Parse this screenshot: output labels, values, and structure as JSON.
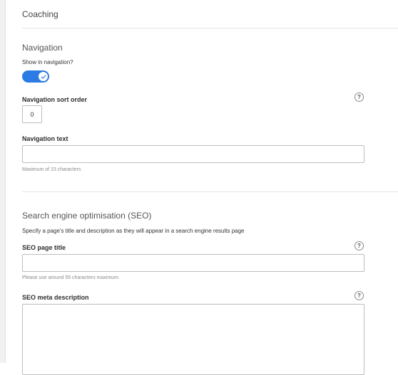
{
  "page": {
    "section_title": "Coaching"
  },
  "navigation": {
    "heading": "Navigation",
    "show_label": "Show in navigation?",
    "show_enabled": true,
    "sort_order_label": "Navigation sort order",
    "sort_order_value": "0",
    "text_label": "Navigation text",
    "text_value": "",
    "text_hint": "Maximum of 15 characters"
  },
  "seo": {
    "heading": "Search engine optimisation (SEO)",
    "description": "Specify a page's title and description as they will appear in a search engine results page",
    "title_label": "SEO page title",
    "title_value": "",
    "title_hint": "Please use around 55 characters maximum",
    "meta_label": "SEO meta description",
    "meta_value": ""
  },
  "help_icon_glyph": "?",
  "colors": {
    "accent": "#2c7be5",
    "border": "#bdbdc2",
    "divider": "#e4e4e8"
  }
}
